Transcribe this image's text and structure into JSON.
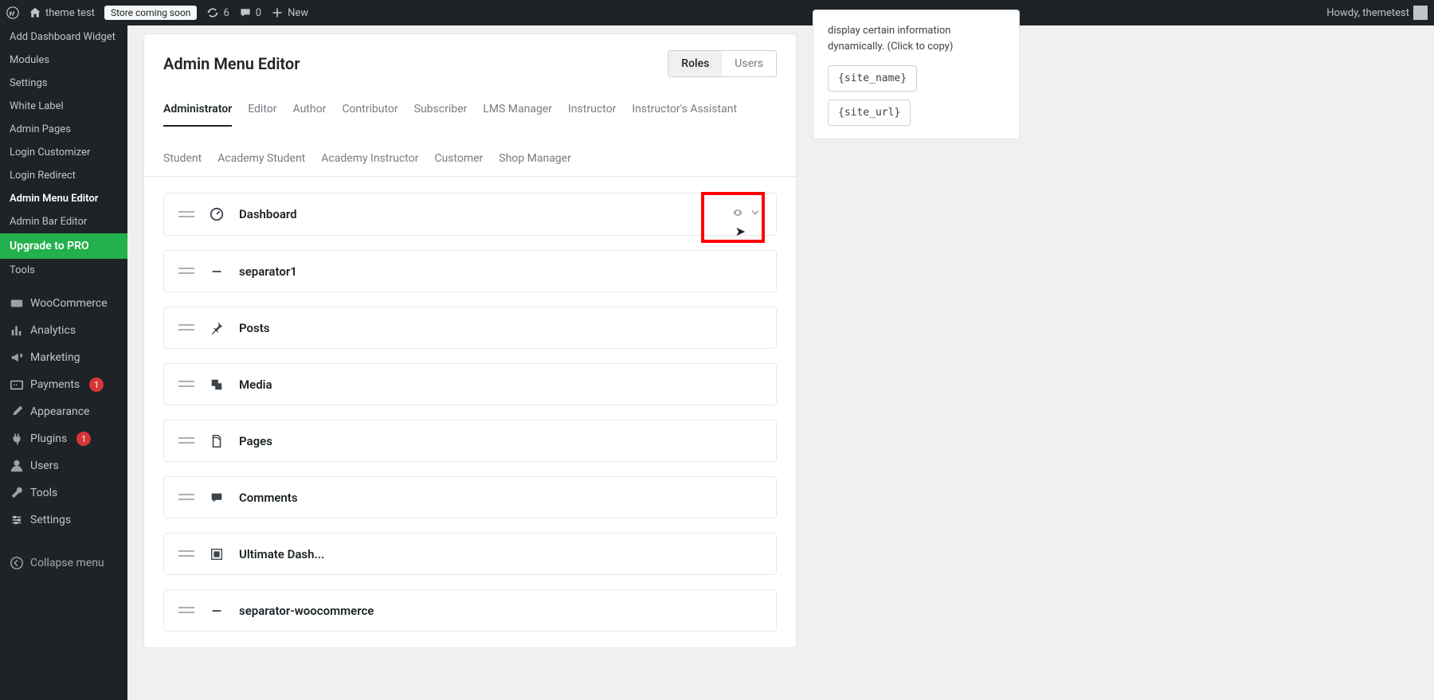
{
  "adminBar": {
    "siteName": "theme test",
    "storeStatus": "Store coming soon",
    "updateCount": "6",
    "commentCount": "0",
    "newLabel": "New",
    "howdy": "Howdy, themetest"
  },
  "sidebar": {
    "subItems": [
      {
        "label": "Add Dashboard Widget",
        "active": false
      },
      {
        "label": "Modules",
        "active": false
      },
      {
        "label": "Settings",
        "active": false
      },
      {
        "label": "White Label",
        "active": false
      },
      {
        "label": "Admin Pages",
        "active": false
      },
      {
        "label": "Login Customizer",
        "active": false
      },
      {
        "label": "Login Redirect",
        "active": false
      },
      {
        "label": "Admin Menu Editor",
        "active": true
      },
      {
        "label": "Admin Bar Editor",
        "active": false
      }
    ],
    "upgrade": "Upgrade to PRO",
    "tools": "Tools",
    "topItems": [
      {
        "label": "WooCommerce",
        "icon": "woo",
        "badge": null
      },
      {
        "label": "Analytics",
        "icon": "chart",
        "badge": null
      },
      {
        "label": "Marketing",
        "icon": "megaphone",
        "badge": null
      },
      {
        "label": "Payments",
        "icon": "payment",
        "badge": "1"
      },
      {
        "label": "Appearance",
        "icon": "brush",
        "badge": null
      },
      {
        "label": "Plugins",
        "icon": "plug",
        "badge": "1"
      },
      {
        "label": "Users",
        "icon": "user",
        "badge": null
      },
      {
        "label": "Tools",
        "icon": "wrench",
        "badge": null
      },
      {
        "label": "Settings",
        "icon": "settings",
        "badge": null
      }
    ],
    "collapse": "Collapse menu"
  },
  "panel": {
    "title": "Admin Menu Editor",
    "toggle": {
      "roles": "Roles",
      "users": "Users"
    }
  },
  "roleTabs": [
    "Administrator",
    "Editor",
    "Author",
    "Contributor",
    "Subscriber",
    "LMS Manager",
    "Instructor",
    "Instructor's Assistant",
    "Student",
    "Academy Student",
    "Academy Instructor",
    "Customer",
    "Shop Manager"
  ],
  "activeRole": "Administrator",
  "menuItems": [
    {
      "label": "Dashboard",
      "icon": "dashboard",
      "highlighted": true
    },
    {
      "label": "separator1",
      "icon": "minus"
    },
    {
      "label": "Posts",
      "icon": "pin"
    },
    {
      "label": "Media",
      "icon": "media"
    },
    {
      "label": "Pages",
      "icon": "page"
    },
    {
      "label": "Comments",
      "icon": "comment"
    },
    {
      "label": "Ultimate Dash...",
      "icon": "widget"
    },
    {
      "label": "separator-woocommerce",
      "icon": "minus"
    }
  ],
  "sidePanel": {
    "desc": "display certain information dynamically. (Click to copy)",
    "codes": [
      "{site_name}",
      "{site_url}"
    ]
  }
}
